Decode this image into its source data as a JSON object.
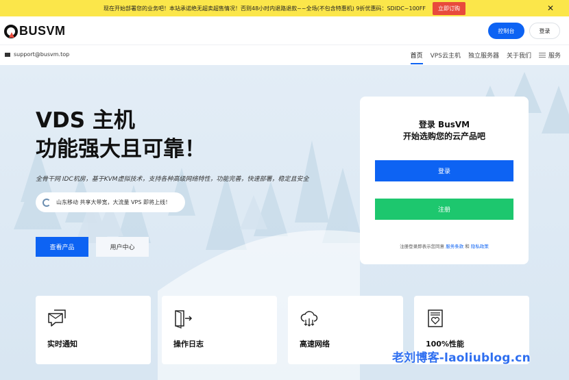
{
  "announcement": {
    "text": "现在开始部署您的业务吧！本站承诺绝无超卖超售情况！否则48小时内退路退款~~全场(不包含特惠机) 9折优惠码：SDIDC~100FF",
    "button": "立即订购",
    "close": "✕"
  },
  "header": {
    "logo_text": "BUSVM",
    "console_label": "控制台",
    "login_label": "登录"
  },
  "subnav": {
    "support_email": "support@busvm.top",
    "nav": [
      "首页",
      "VPS云主机",
      "独立服务器",
      "关于我们",
      "服务"
    ]
  },
  "hero": {
    "title_line1": "VDS 主机",
    "title_line2": "功能强大且可靠！",
    "description": "全骨干网 IDC机房，基于KVM虚拟技术，支持各种高级网络特性，功能完善，快速部署，稳定且安全",
    "promo_text": "山东移动 共享大带宽，大流量 VPS 即将上线！",
    "btn_products": "查看产品",
    "btn_user_center": "用户中心"
  },
  "login_card": {
    "title_line1": "登录 BusVM",
    "title_line2": "开始选购您的云产品吧",
    "login_btn": "登录",
    "register_btn": "注册",
    "terms_prefix": "注册登录即表示您同意",
    "terms_link1": "服务条款",
    "terms_and": "和",
    "terms_link2": "隐私政策"
  },
  "features": [
    {
      "label": "实时通知",
      "icon": "message-icon"
    },
    {
      "label": "操作日志",
      "icon": "log-door-icon"
    },
    {
      "label": "高速网络",
      "icon": "cloud-download-icon"
    },
    {
      "label": "100%性能",
      "icon": "performance-heart-icon"
    }
  ],
  "watermark": "老刘博客-laoliublog.cn",
  "colors": {
    "accent_blue": "#0d63f3",
    "register_green": "#1dc76e",
    "announce_yellow": "#fbe64a",
    "announce_red": "#e84a3c"
  }
}
